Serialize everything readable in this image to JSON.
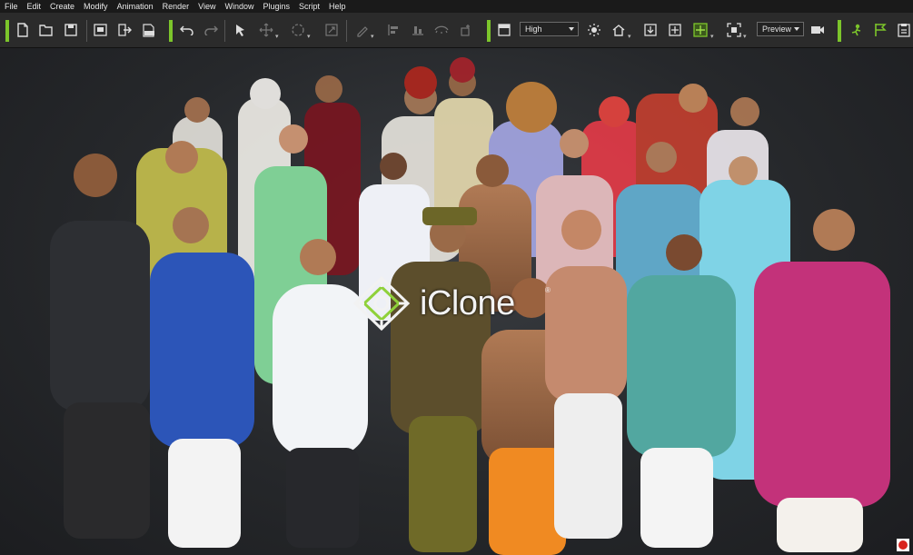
{
  "menu": {
    "items": [
      {
        "label": "File"
      },
      {
        "label": "Edit"
      },
      {
        "label": "Create"
      },
      {
        "label": "Modify"
      },
      {
        "label": "Animation"
      },
      {
        "label": "Render"
      },
      {
        "label": "View"
      },
      {
        "label": "Window"
      },
      {
        "label": "Plugins"
      },
      {
        "label": "Script"
      },
      {
        "label": "Help"
      }
    ]
  },
  "toolbar": {
    "quality_value": "High",
    "preview_value": "Preview",
    "accent_color": "#7cc52b"
  },
  "viewport": {
    "logo_text": "iClone",
    "logo_registered": "®"
  }
}
